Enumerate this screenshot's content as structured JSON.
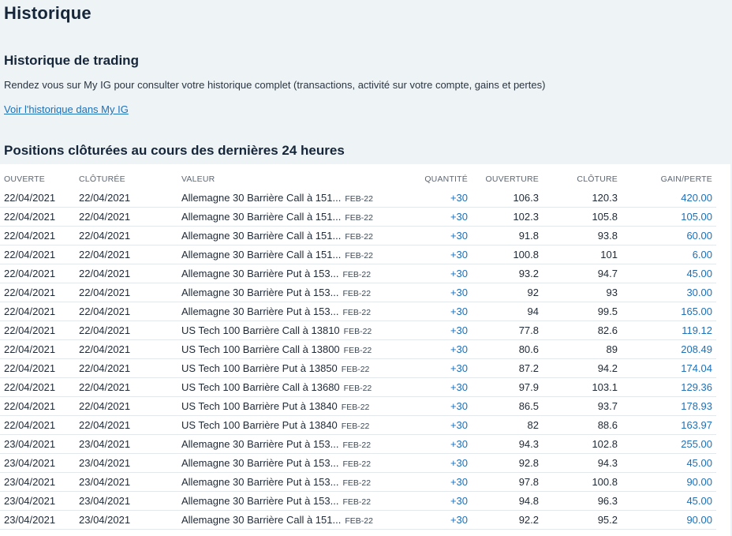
{
  "page": {
    "title": "Historique",
    "trading_title": "Historique de trading",
    "description": "Rendez vous sur My IG pour consulter votre historique complet (transactions, activité sur votre compte, gains et pertes)",
    "link_label": "Voir l'historique dans My IG",
    "positions_title": "Positions clôturées au cours des dernières 24 heures"
  },
  "table": {
    "headers": {
      "ouverte": "OUVERTE",
      "cloturee": "CLÔTURÉE",
      "valeur": "VALEUR",
      "quantite": "QUANTITÉ",
      "ouverture": "OUVERTURE",
      "cloture": "CLÔTURE",
      "gain": "GAIN/PERTE"
    },
    "rows": [
      {
        "open": "22/04/2021",
        "close": "22/04/2021",
        "value": "Allemagne 30 Barrière Call à 151...",
        "expiry": "FEB-22",
        "qty": "+30",
        "ouv": "106.3",
        "clo": "120.3",
        "gain": "420.00"
      },
      {
        "open": "22/04/2021",
        "close": "22/04/2021",
        "value": "Allemagne 30 Barrière Call à 151...",
        "expiry": "FEB-22",
        "qty": "+30",
        "ouv": "102.3",
        "clo": "105.8",
        "gain": "105.00"
      },
      {
        "open": "22/04/2021",
        "close": "22/04/2021",
        "value": "Allemagne 30 Barrière Call à 151...",
        "expiry": "FEB-22",
        "qty": "+30",
        "ouv": "91.8",
        "clo": "93.8",
        "gain": "60.00"
      },
      {
        "open": "22/04/2021",
        "close": "22/04/2021",
        "value": "Allemagne 30 Barrière Call à 151...",
        "expiry": "FEB-22",
        "qty": "+30",
        "ouv": "100.8",
        "clo": "101",
        "gain": "6.00"
      },
      {
        "open": "22/04/2021",
        "close": "22/04/2021",
        "value": "Allemagne 30 Barrière Put à 153...",
        "expiry": "FEB-22",
        "qty": "+30",
        "ouv": "93.2",
        "clo": "94.7",
        "gain": "45.00"
      },
      {
        "open": "22/04/2021",
        "close": "22/04/2021",
        "value": "Allemagne 30 Barrière Put à 153...",
        "expiry": "FEB-22",
        "qty": "+30",
        "ouv": "92",
        "clo": "93",
        "gain": "30.00"
      },
      {
        "open": "22/04/2021",
        "close": "22/04/2021",
        "value": "Allemagne 30 Barrière Put à 153...",
        "expiry": "FEB-22",
        "qty": "+30",
        "ouv": "94",
        "clo": "99.5",
        "gain": "165.00"
      },
      {
        "open": "22/04/2021",
        "close": "22/04/2021",
        "value": "US Tech 100 Barrière Call à 13810",
        "expiry": "FEB-22",
        "qty": "+30",
        "ouv": "77.8",
        "clo": "82.6",
        "gain": "119.12"
      },
      {
        "open": "22/04/2021",
        "close": "22/04/2021",
        "value": "US Tech 100 Barrière Call à 13800",
        "expiry": "FEB-22",
        "qty": "+30",
        "ouv": "80.6",
        "clo": "89",
        "gain": "208.49"
      },
      {
        "open": "22/04/2021",
        "close": "22/04/2021",
        "value": "US Tech 100 Barrière Put à 13850",
        "expiry": "FEB-22",
        "qty": "+30",
        "ouv": "87.2",
        "clo": "94.2",
        "gain": "174.04"
      },
      {
        "open": "22/04/2021",
        "close": "22/04/2021",
        "value": "US Tech 100 Barrière Call à 13680",
        "expiry": "FEB-22",
        "qty": "+30",
        "ouv": "97.9",
        "clo": "103.1",
        "gain": "129.36"
      },
      {
        "open": "22/04/2021",
        "close": "22/04/2021",
        "value": "US Tech 100 Barrière Put à 13840",
        "expiry": "FEB-22",
        "qty": "+30",
        "ouv": "86.5",
        "clo": "93.7",
        "gain": "178.93"
      },
      {
        "open": "22/04/2021",
        "close": "22/04/2021",
        "value": "US Tech 100 Barrière Put à 13840",
        "expiry": "FEB-22",
        "qty": "+30",
        "ouv": "82",
        "clo": "88.6",
        "gain": "163.97"
      },
      {
        "open": "23/04/2021",
        "close": "23/04/2021",
        "value": "Allemagne 30 Barrière Put à 153...",
        "expiry": "FEB-22",
        "qty": "+30",
        "ouv": "94.3",
        "clo": "102.8",
        "gain": "255.00"
      },
      {
        "open": "23/04/2021",
        "close": "23/04/2021",
        "value": "Allemagne 30 Barrière Put à 153...",
        "expiry": "FEB-22",
        "qty": "+30",
        "ouv": "92.8",
        "clo": "94.3",
        "gain": "45.00"
      },
      {
        "open": "23/04/2021",
        "close": "23/04/2021",
        "value": "Allemagne 30 Barrière Put à 153...",
        "expiry": "FEB-22",
        "qty": "+30",
        "ouv": "97.8",
        "clo": "100.8",
        "gain": "90.00"
      },
      {
        "open": "23/04/2021",
        "close": "23/04/2021",
        "value": "Allemagne 30 Barrière Put à 153...",
        "expiry": "FEB-22",
        "qty": "+30",
        "ouv": "94.8",
        "clo": "96.3",
        "gain": "45.00"
      },
      {
        "open": "23/04/2021",
        "close": "23/04/2021",
        "value": "Allemagne 30 Barrière Call à 151...",
        "expiry": "FEB-22",
        "qty": "+30",
        "ouv": "92.2",
        "clo": "95.2",
        "gain": "90.00"
      }
    ]
  },
  "colors": {
    "background": "#eef3f5",
    "link": "#1e6fb8",
    "title": "#16263a"
  }
}
